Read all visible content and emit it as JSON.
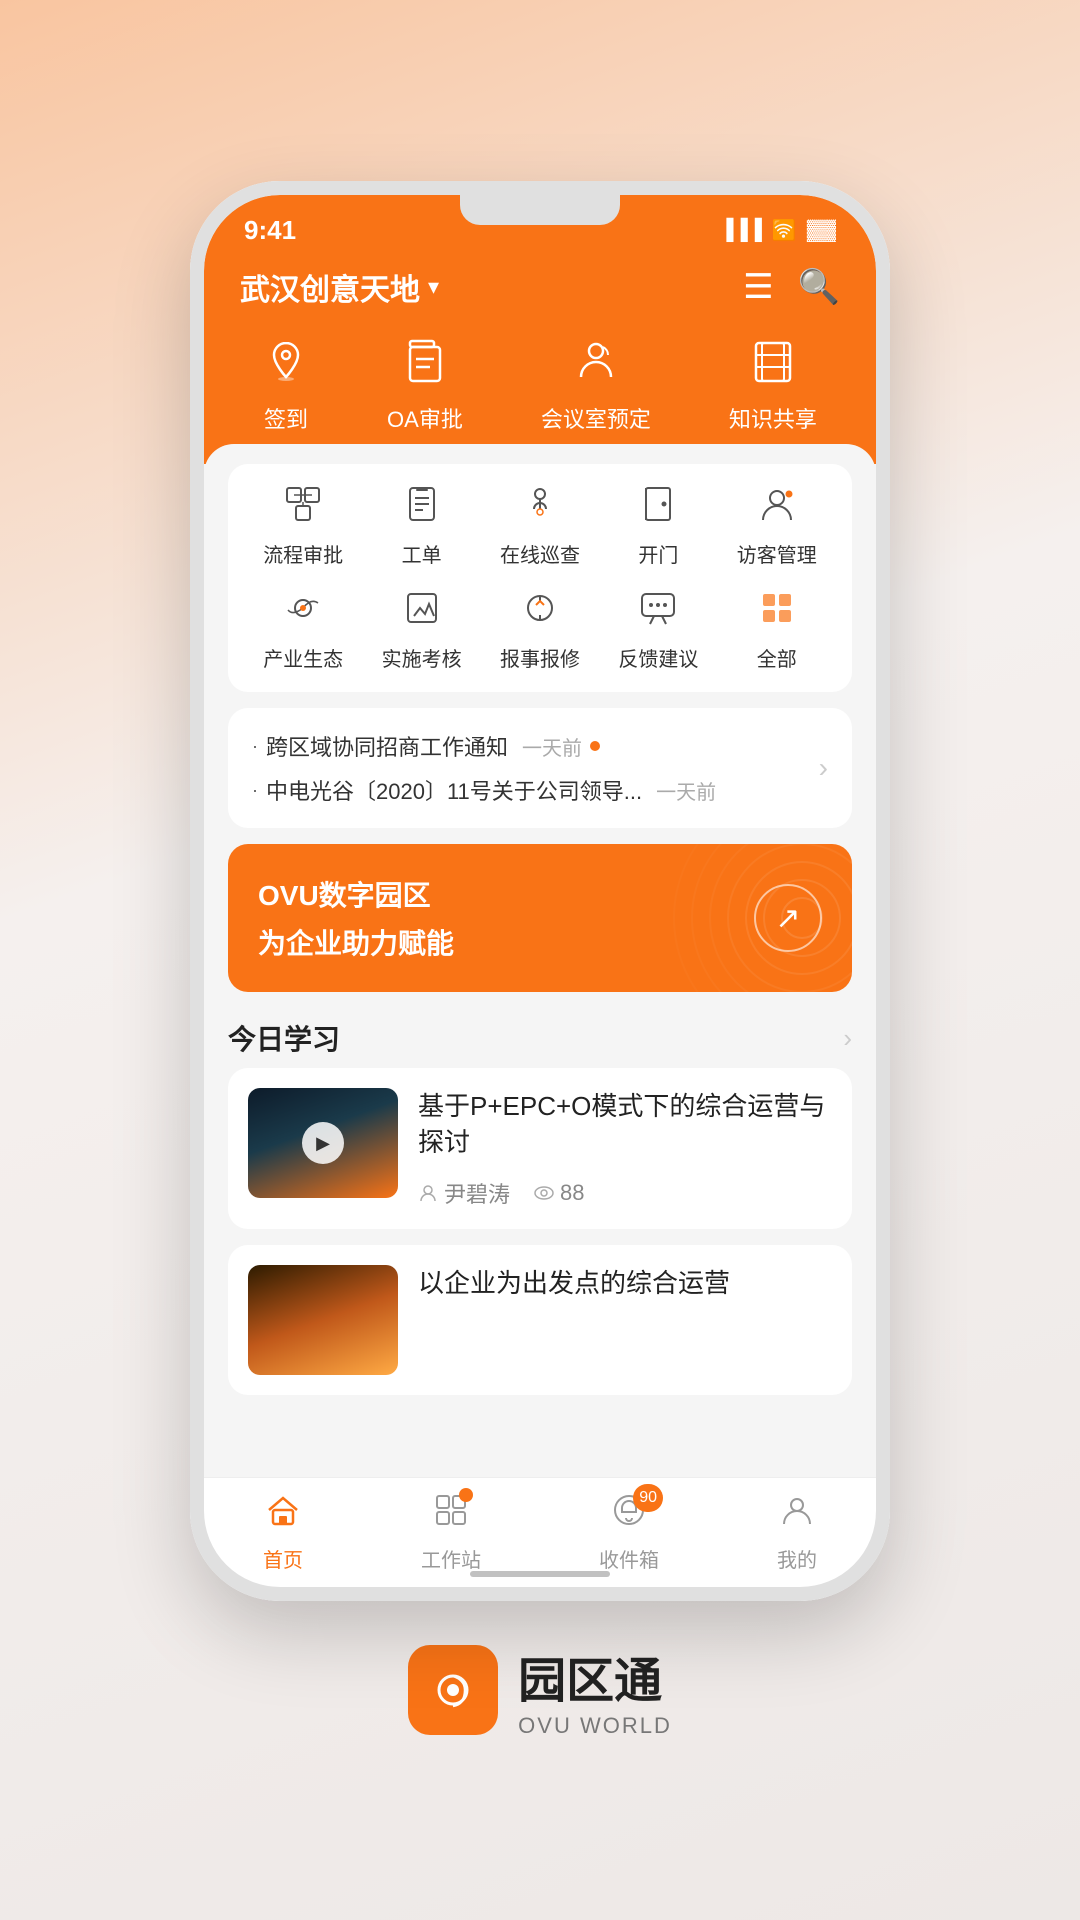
{
  "status_bar": {
    "time": "9:41"
  },
  "header": {
    "location": "武汉创意天地",
    "dropdown_icon": "▾"
  },
  "quick_nav": [
    {
      "label": "签到",
      "icon": "📍"
    },
    {
      "label": "OA审批",
      "icon": "⚗"
    },
    {
      "label": "会议室预定",
      "icon": "🪑"
    },
    {
      "label": "知识共享",
      "icon": "📖"
    }
  ],
  "services": {
    "row1": [
      {
        "label": "流程审批",
        "icon": "🔄"
      },
      {
        "label": "工单",
        "icon": "📋"
      },
      {
        "label": "在线巡查",
        "icon": "🔍"
      },
      {
        "label": "开门",
        "icon": "🚪"
      },
      {
        "label": "访客管理",
        "icon": "👤"
      }
    ],
    "row2": [
      {
        "label": "产业生态",
        "icon": "🔁"
      },
      {
        "label": "实施考核",
        "icon": "📊"
      },
      {
        "label": "报事报修",
        "icon": "⚙"
      },
      {
        "label": "反馈建议",
        "icon": "💬"
      },
      {
        "label": "全部",
        "icon": "⠿"
      }
    ]
  },
  "notifications": [
    {
      "text": "跨区域协同招商工作通知",
      "time": "一天前",
      "has_dot": true
    },
    {
      "text": "中电光谷〔2020〕11号关于公司领导...",
      "time": "一天前",
      "has_dot": false
    }
  ],
  "banner": {
    "title": "OVU数字园区",
    "subtitle": "为企业助力赋能"
  },
  "today_learning": {
    "section_title": "今日学习",
    "cards": [
      {
        "title": "基于P+EPC+O模式下的综合运营与探讨",
        "author": "尹碧涛",
        "views": "88"
      },
      {
        "title": "以企业为出发点的综合运营",
        "author": "",
        "views": ""
      }
    ]
  },
  "tab_bar": {
    "items": [
      {
        "label": "首页",
        "active": true,
        "badge": null
      },
      {
        "label": "工作站",
        "active": false,
        "badge": "dot"
      },
      {
        "label": "收件箱",
        "active": false,
        "badge": "90"
      },
      {
        "label": "我的",
        "active": false,
        "badge": null
      }
    ]
  },
  "brand": {
    "name_cn": "园区通",
    "name_en": "OVU WORLD"
  }
}
